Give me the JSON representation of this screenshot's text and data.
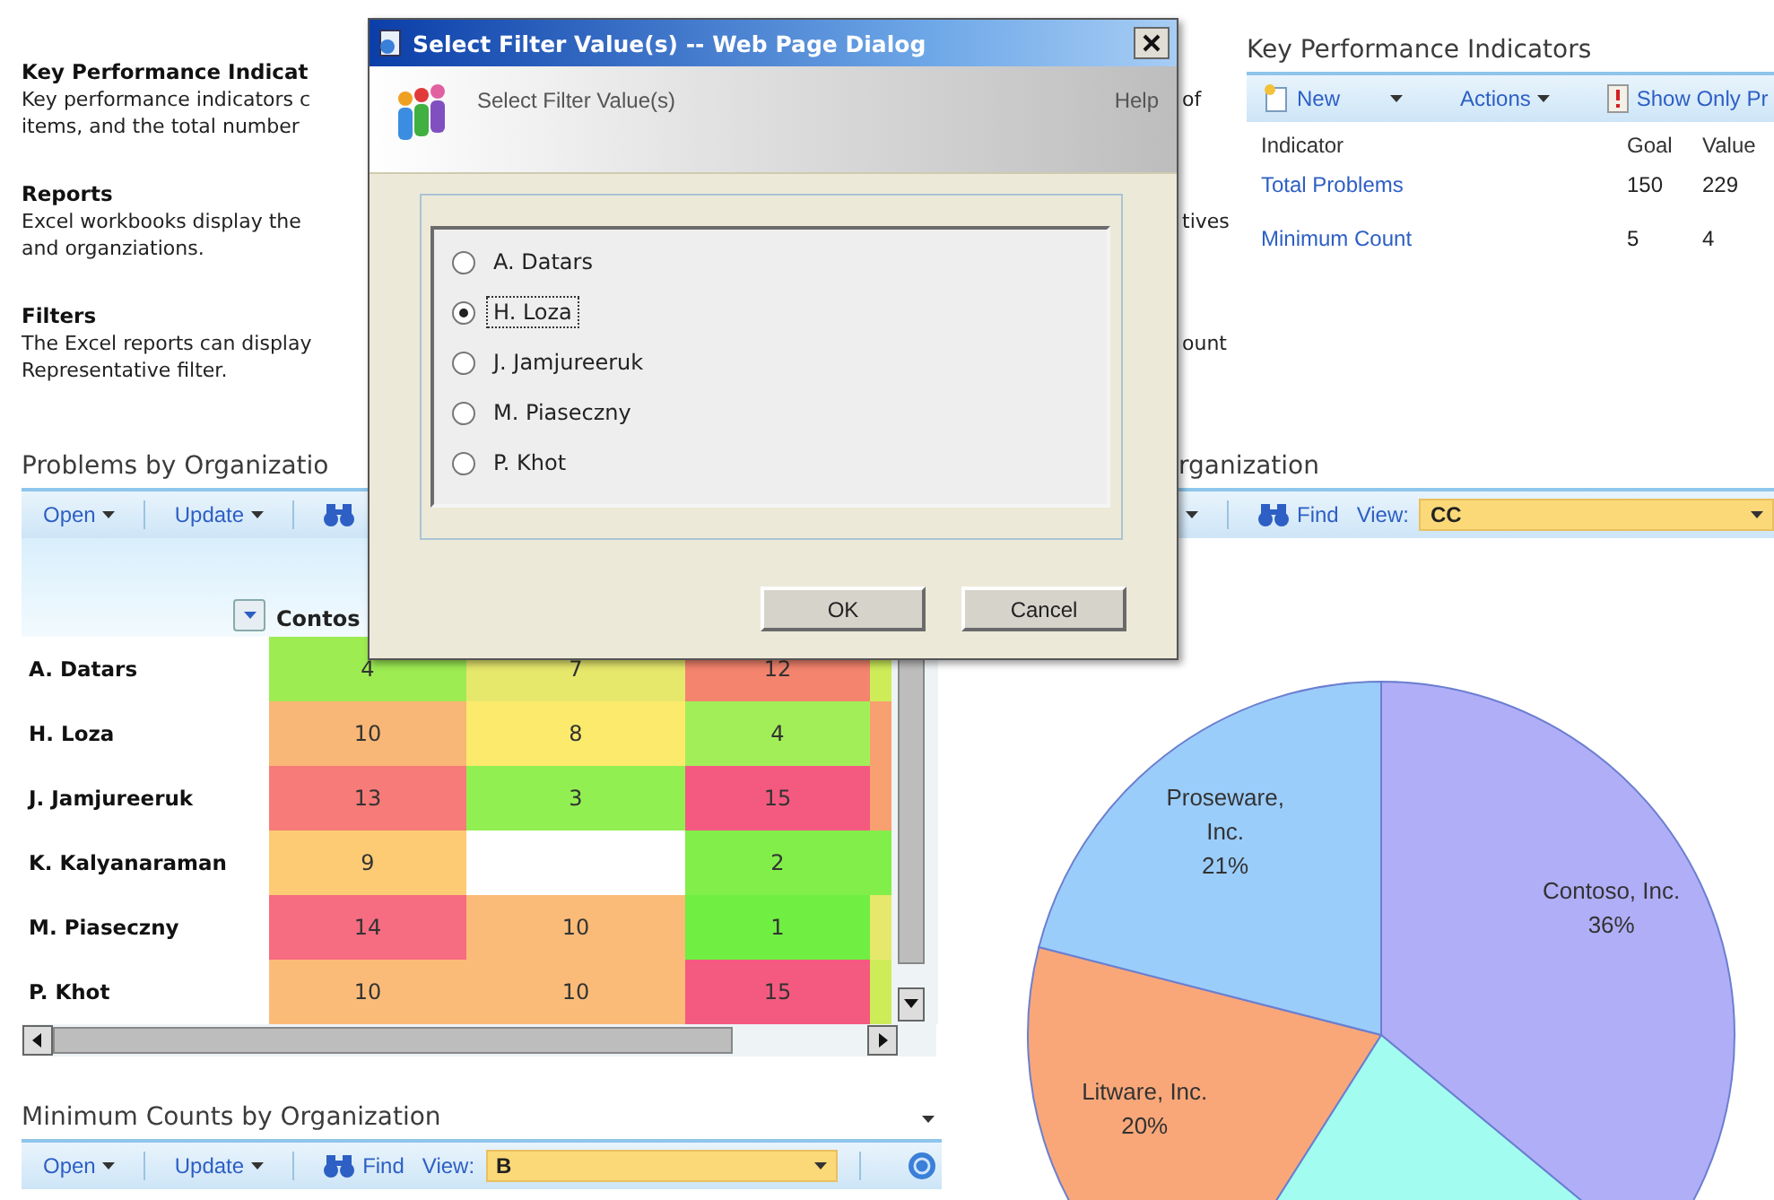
{
  "sections": [
    {
      "heading": "Key Performance Indicat",
      "lines": [
        {
          "text": "Key performance indicators c",
          "visible_end": "of"
        },
        {
          "text": "items, and the total number"
        }
      ]
    },
    {
      "heading": "Reports",
      "lines": [
        {
          "text": "Excel workbooks display the",
          "visible_end": "tives"
        },
        {
          "text": "and organziations."
        }
      ]
    },
    {
      "heading": "Filters",
      "lines": [
        {
          "text": "The Excel reports can display",
          "visible_end": "ount"
        },
        {
          "text": "Representative filter."
        }
      ]
    }
  ],
  "kpi_panel": {
    "title": "Key Performance Indicators",
    "toolbar": [
      {
        "label": "New",
        "kind": "create"
      },
      {
        "label": "Actions",
        "kind": "menu"
      },
      {
        "label": "Show Only Pr",
        "kind": "filter"
      }
    ],
    "columns": [
      "Indicator",
      "Goal",
      "Value"
    ],
    "rows": [
      {
        "indicator": "Total Problems",
        "goal": "150",
        "value": "229"
      },
      {
        "indicator": "Minimum Count",
        "goal": "5",
        "value": "4"
      }
    ]
  },
  "problems_part": {
    "title": "Problems by Organizatio",
    "toolbar": [
      {
        "label": "Open",
        "kind": "menu"
      },
      {
        "label": "Update",
        "kind": "menu"
      },
      {
        "kind": "find"
      }
    ],
    "column_header": "Contos",
    "rows": [
      {
        "name": "A. Datars",
        "cells": [
          {
            "value": "4",
            "color": "#9cec52"
          },
          {
            "value": "7",
            "color": "#e6e86c"
          },
          {
            "value": "12",
            "color": "#f4846e"
          },
          {
            "color": "#cdec58"
          }
        ]
      },
      {
        "name": "H. Loza",
        "cells": [
          {
            "value": "10",
            "color": "#f8b776"
          },
          {
            "value": "8",
            "color": "#fbea6c"
          },
          {
            "value": "4",
            "color": "#a2ee58"
          },
          {
            "color": "#f8a070"
          }
        ]
      },
      {
        "name": "J. Jamjureeruk",
        "cells": [
          {
            "value": "13",
            "color": "#f77b78"
          },
          {
            "value": "3",
            "color": "#92ef52"
          },
          {
            "value": "15",
            "color": "#f45a80"
          },
          {
            "color": "#f8a070"
          }
        ]
      },
      {
        "name": "K. Kalyanaraman",
        "cells": [
          {
            "value": "9",
            "color": "#fccb74"
          },
          null,
          {
            "value": "2",
            "color": "#82ee4a"
          },
          {
            "color": "#82ee4a"
          }
        ]
      },
      {
        "name": "M. Piaseczny",
        "cells": [
          {
            "value": "14",
            "color": "#f66c80"
          },
          {
            "value": "10",
            "color": "#fbbb78"
          },
          {
            "value": "1",
            "color": "#70ee42"
          },
          {
            "color": "#e6e86c"
          }
        ]
      },
      {
        "name": "P. Khot",
        "cells": [
          {
            "value": "10",
            "color": "#fbbb78"
          },
          {
            "value": "10",
            "color": "#fbbb78"
          },
          {
            "value": "15",
            "color": "#f45a80"
          },
          {
            "color": "#cdec58"
          }
        ]
      }
    ]
  },
  "minimum_part": {
    "title": "Minimum Counts by Organization",
    "toolbar": [
      {
        "label": "Open",
        "kind": "menu"
      },
      {
        "label": "Update",
        "kind": "menu"
      },
      {
        "label": "Find",
        "kind": "find"
      },
      {
        "label": "View:",
        "kind": "view",
        "value": "B"
      },
      {
        "kind": "help"
      }
    ]
  },
  "chart_part": {
    "title": "rganization",
    "toolbar": [
      {
        "kind": "caret"
      },
      {
        "label": "Find",
        "kind": "find"
      },
      {
        "label": "View:",
        "kind": "view",
        "value": "CC"
      }
    ],
    "chart_data": {
      "type": "pie",
      "categories": [
        "Contoso, Inc.",
        null,
        "Litware, Inc.",
        "Proseware, Inc."
      ],
      "values": [
        36,
        23,
        20,
        21
      ],
      "colors": [
        "#b1aef8",
        "#a2fcef",
        "#f9a779",
        "#9bcdfb"
      ],
      "value_labels": [
        "36%",
        null,
        "20%",
        "21%"
      ]
    }
  },
  "dialog": {
    "title": "Select Filter Value(s) -- Web Page Dialog",
    "heading": "Select Filter Value(s)",
    "help": "Help",
    "options": [
      {
        "label": "A. Datars",
        "selected": false
      },
      {
        "label": "H. Loza",
        "selected": true
      },
      {
        "label": "J. Jamjureeruk",
        "selected": false
      },
      {
        "label": "M. Piaseczny",
        "selected": false
      },
      {
        "label": "P. Khot",
        "selected": false
      }
    ],
    "buttons": [
      "OK",
      "Cancel"
    ]
  }
}
